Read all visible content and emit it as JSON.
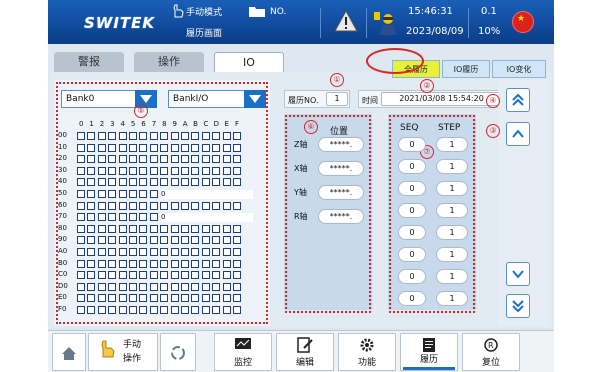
{
  "header": {
    "logo": "SWITEK",
    "mode": "手动模式",
    "screen": "履历画面",
    "program_label": "NO.",
    "time": "15:46:31",
    "date": "2023/08/09",
    "speed": "0.1",
    "speed_pct": "10%",
    "flag_star": "★"
  },
  "tabs": [
    {
      "label": "警报",
      "active": false
    },
    {
      "label": "操作",
      "active": false
    },
    {
      "label": "IO",
      "active": true
    }
  ],
  "subtabs": [
    {
      "label": "全履历",
      "active": true
    },
    {
      "label": "IO履历",
      "active": false
    },
    {
      "label": "IO变化",
      "active": false
    }
  ],
  "dropdowns": {
    "bank": "Bank0",
    "bank_io": "BankI/O"
  },
  "grid": {
    "columns": [
      "0",
      "1",
      "2",
      "3",
      "4",
      "5",
      "6",
      "7",
      "8",
      "9",
      "A",
      "B",
      "C",
      "D",
      "E",
      "F"
    ],
    "rows": [
      "00",
      "10",
      "20",
      "30",
      "40",
      "50",
      "60",
      "70",
      "80",
      "90",
      "A0",
      "B0",
      "C0",
      "D0",
      "E0",
      "F0"
    ],
    "value_rows": [
      {
        "row": "50",
        "value": "0"
      },
      {
        "row": "70",
        "value": "0"
      }
    ]
  },
  "history": {
    "no_label": "履历NO.",
    "no_value": "1",
    "time_label": "时间",
    "time_value": "2021/03/08 15:54:20"
  },
  "position": {
    "title": "位置",
    "axes": [
      {
        "label": "Z轴",
        "value": "*****."
      },
      {
        "label": "X轴",
        "value": "*****."
      },
      {
        "label": "Y轴",
        "value": "*****."
      },
      {
        "label": "R轴",
        "value": "*****."
      }
    ]
  },
  "seq": {
    "seq_label": "SEQ",
    "step_label": "STEP",
    "rows": [
      {
        "seq": "0",
        "step": "1"
      },
      {
        "seq": "0",
        "step": "1"
      },
      {
        "seq": "0",
        "step": "1"
      },
      {
        "seq": "0",
        "step": "1"
      },
      {
        "seq": "0",
        "step": "1"
      },
      {
        "seq": "0",
        "step": "1"
      },
      {
        "seq": "0",
        "step": "1"
      },
      {
        "seq": "0",
        "step": "1"
      }
    ]
  },
  "callouts": [
    "①",
    "②",
    "③",
    "④",
    "⑤",
    "⑥",
    "⑦"
  ],
  "bottom": {
    "manual_op": "手动",
    "manual_op2": "操作",
    "monitor": "监控",
    "edit": "编辑",
    "function": "功能",
    "history": "履历",
    "reset": "复位"
  },
  "colors": {
    "header": "#0a3d88",
    "accent": "#1b6fc6",
    "callout": "#d7262a",
    "active_subtab": "#e6f23a"
  }
}
